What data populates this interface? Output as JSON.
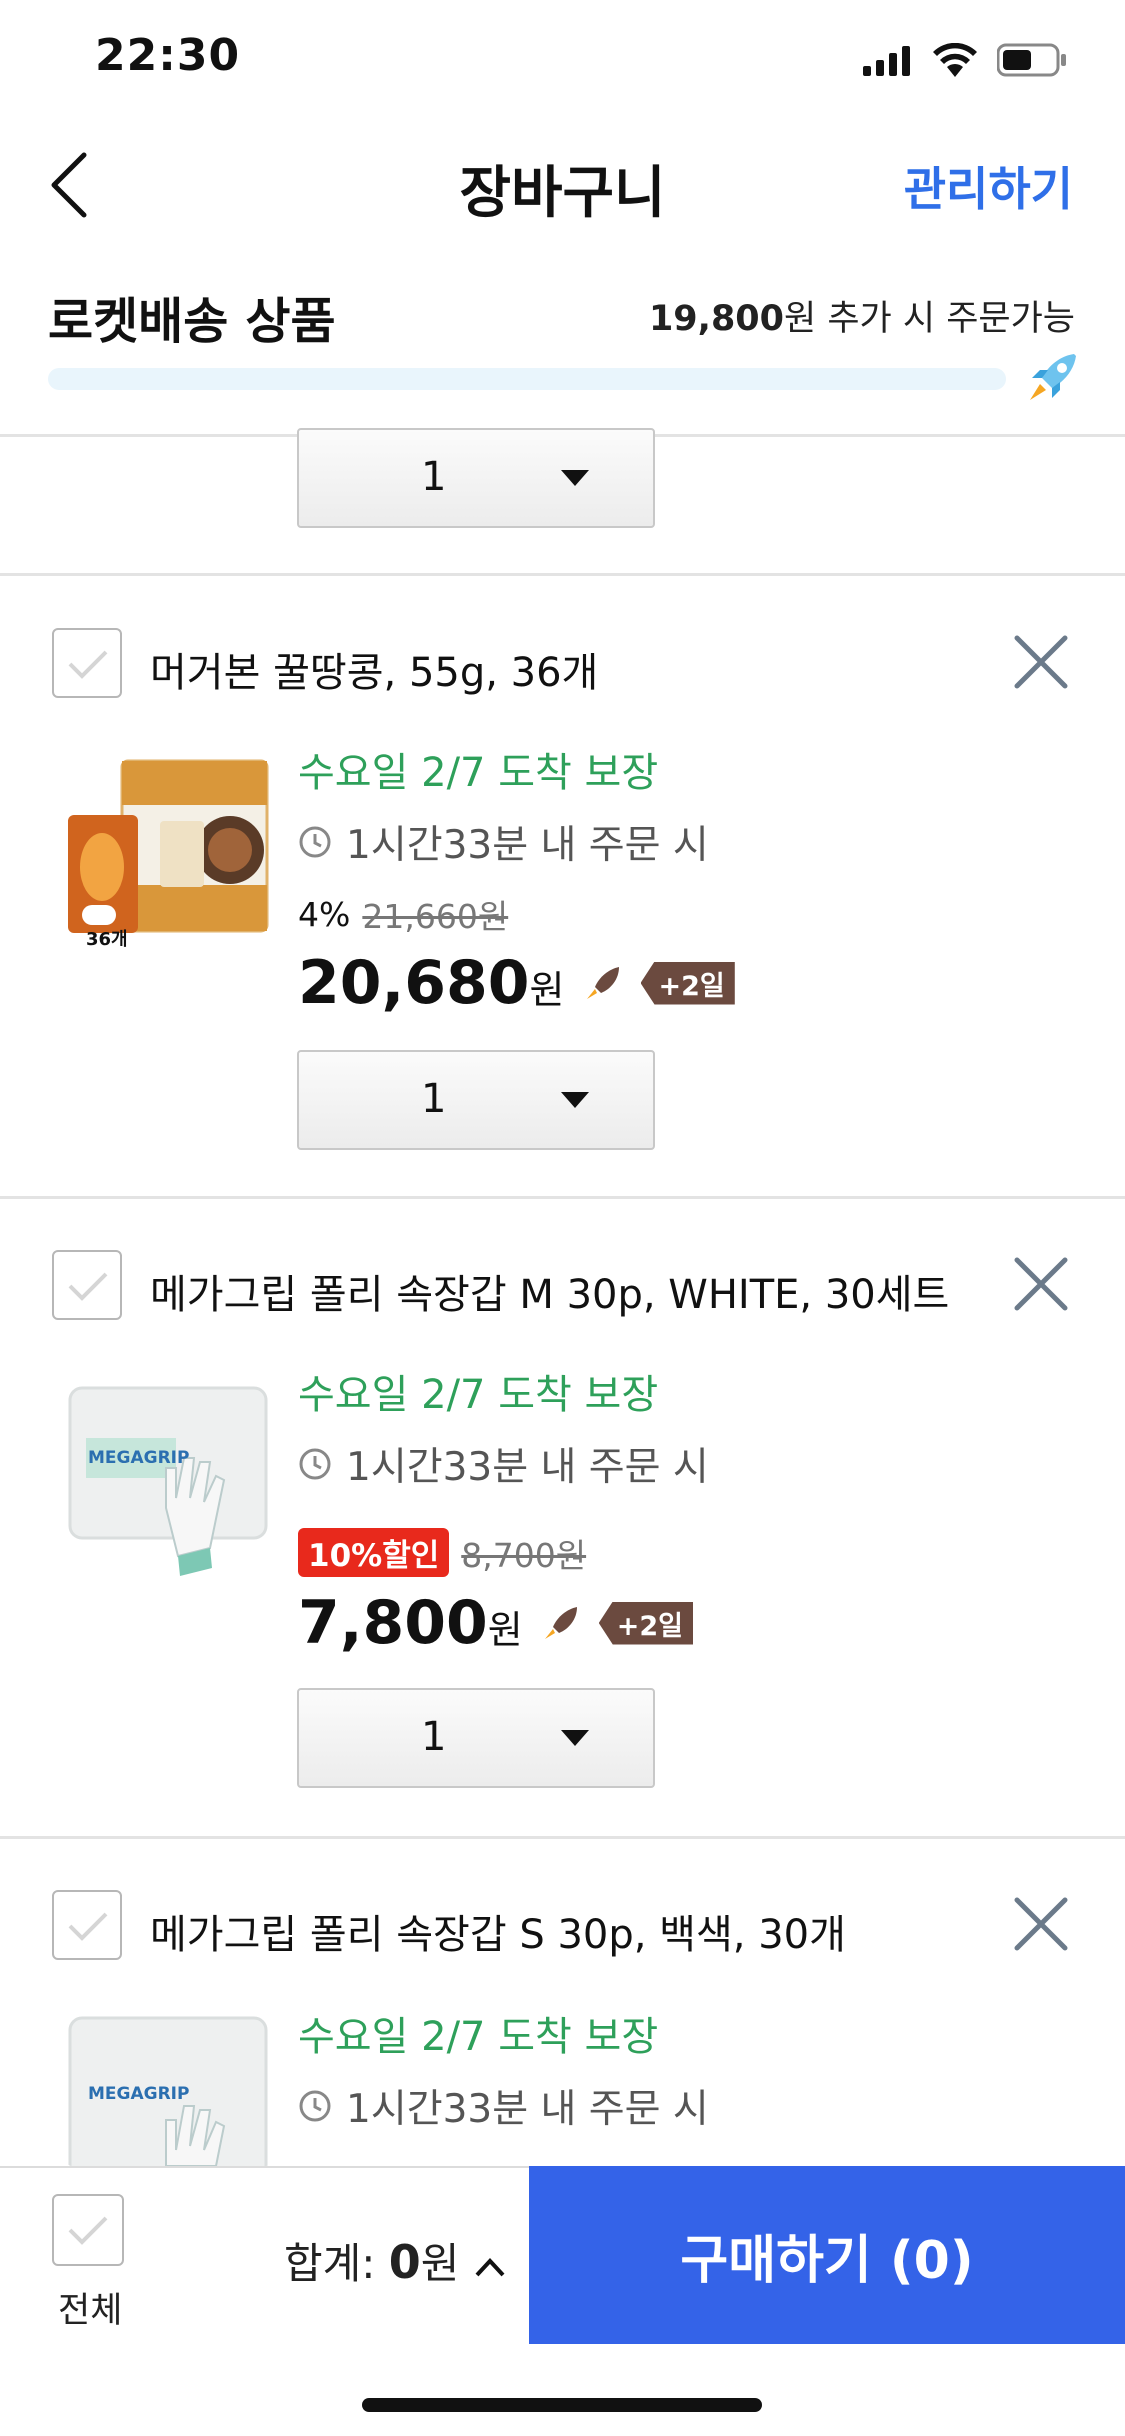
{
  "status_bar": {
    "time": "22:30",
    "battery_level": 0.55
  },
  "header": {
    "title": "장바구니",
    "manage_label": "관리하기"
  },
  "rocket_section": {
    "title": "로켓배송 상품",
    "note_amount": "19,800",
    "note_unit": "원 추가 시 주문가능",
    "progress": 0.0
  },
  "partial_item": {
    "quantity": "1"
  },
  "items": [
    {
      "name": "머거본 꿀땅콩, 55g, 36개",
      "arrival": "수요일 2/7 도착 보장",
      "deadline": "1시간33분 내 주문 시",
      "discount": "4%",
      "original_price": "21,660원",
      "price": "20,680",
      "price_unit": "원",
      "delivery_badge": "+2일",
      "quantity": "1",
      "thumb_label": "36개"
    },
    {
      "name": "메가그립 폴리 속장갑 M 30p, WHITE, 30세트",
      "arrival": "수요일 2/7 도착 보장",
      "deadline": "1시간33분 내 주문 시",
      "discount_badge": "10%할인",
      "original_price": "8,700원",
      "price": "7,800",
      "price_unit": "원",
      "delivery_badge": "+2일",
      "quantity": "1",
      "thumb_label": "MEGAGRIP"
    },
    {
      "name": "메가그립 폴리 속장갑 S 30p, 백색, 30개",
      "arrival": "수요일 2/7 도착 보장",
      "deadline": "1시간33분 내 주문 시",
      "thumb_label": "MEGAGRIP"
    }
  ],
  "bottom_bar": {
    "select_all_label": "전체",
    "total_prefix": "합계: ",
    "total_amount": "0",
    "total_unit": "원",
    "buy_label": "구매하기 (0)"
  },
  "colors": {
    "accent": "#3463e8",
    "arrival_green": "#2ea05a",
    "discount_red": "#e8291c",
    "link_blue": "#2f6fe8"
  },
  "icons": [
    "back-icon",
    "rocket-icon",
    "clock-icon",
    "close-icon",
    "check-icon",
    "caret-down-icon",
    "chevron-up-icon"
  ]
}
